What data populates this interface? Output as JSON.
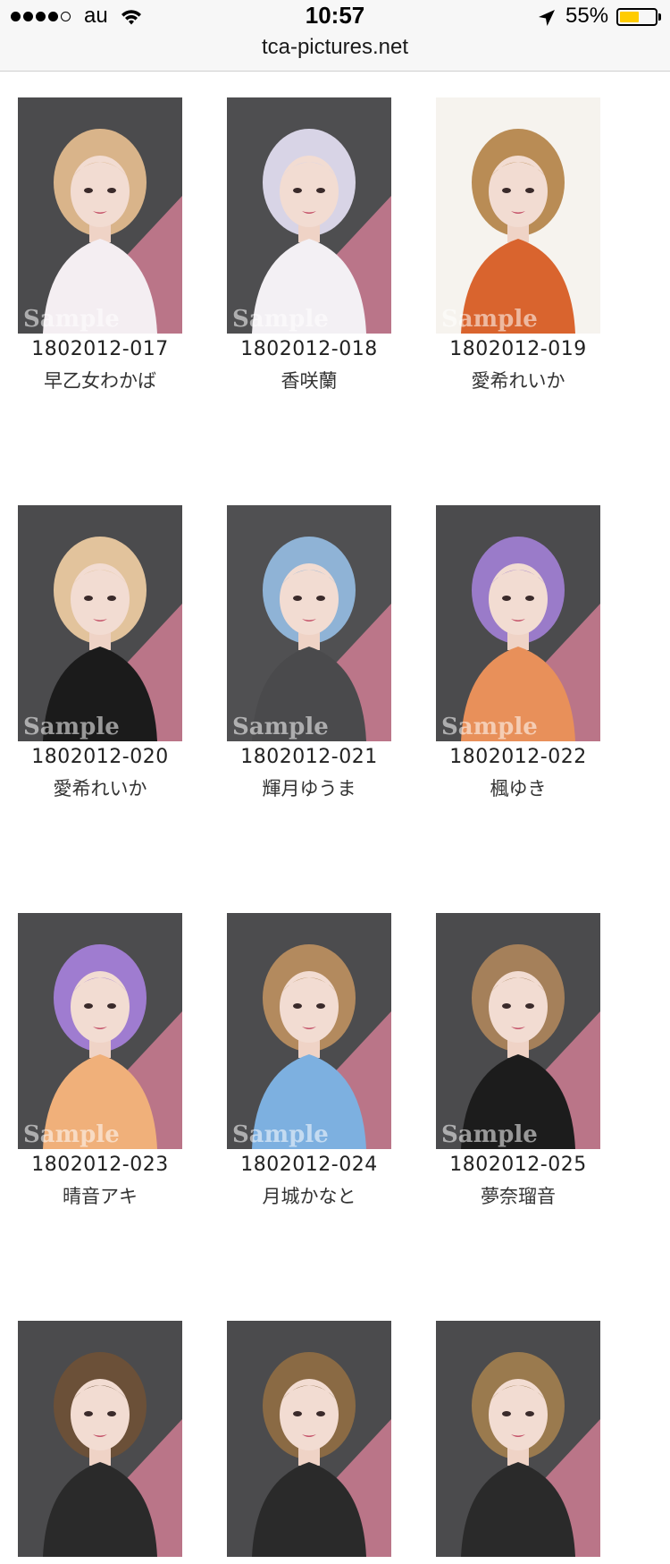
{
  "status_bar": {
    "carrier": "au",
    "time": "10:57",
    "battery_percent": "55%",
    "battery_level": 0.55,
    "signal_bars_filled": 4,
    "signal_bars_total": 5,
    "icons": [
      "wifi-icon",
      "location-arrow-icon",
      "battery-icon"
    ]
  },
  "browser": {
    "url": "tca-pictures.net"
  },
  "items": [
    {
      "code": "1802012-017",
      "name": "早乙女わかば",
      "watermark": "Sample",
      "bg": "#4b4b4d",
      "hair": "#d9b48a",
      "outfit": "#f4eef2",
      "accent": "#c77a8f",
      "light_bg": false
    },
    {
      "code": "1802012-018",
      "name": "香咲蘭",
      "watermark": "Sample",
      "bg": "#4e4e50",
      "hair": "#d8d4e6",
      "outfit": "#f3f0f4",
      "accent": "#c77a8f",
      "light_bg": false
    },
    {
      "code": "1802012-019",
      "name": "愛希れいか",
      "watermark": "Sample",
      "bg": "#f6f3ee",
      "hair": "#b98c55",
      "outfit": "#d9642e",
      "accent": "#f1e7b8",
      "light_bg": true
    },
    {
      "code": "1802012-020",
      "name": "愛希れいか",
      "watermark": "Sample",
      "bg": "#4b4b4d",
      "hair": "#e2c39c",
      "outfit": "#1b1b1b",
      "accent": "#c77a8f",
      "light_bg": false
    },
    {
      "code": "1802012-021",
      "name": "輝月ゆうま",
      "watermark": "Sample",
      "bg": "#505052",
      "hair": "#8fb3d6",
      "outfit": "#4a4a4c",
      "accent": "#c77a8f",
      "light_bg": false
    },
    {
      "code": "1802012-022",
      "name": "楓ゆき",
      "watermark": "Sample",
      "bg": "#4b4b4d",
      "hair": "#9a7bc9",
      "outfit": "#e8905a",
      "accent": "#c77a8f",
      "light_bg": false
    },
    {
      "code": "1802012-023",
      "name": "晴音アキ",
      "watermark": "Sample",
      "bg": "#4c4c4e",
      "hair": "#9f7cd0",
      "outfit": "#f0b07a",
      "accent": "#c77a8f",
      "light_bg": false
    },
    {
      "code": "1802012-024",
      "name": "月城かなと",
      "watermark": "Sample",
      "bg": "#4c4c4e",
      "hair": "#b38a5e",
      "outfit": "#7db0e0",
      "accent": "#c77a8f",
      "light_bg": false
    },
    {
      "code": "1802012-025",
      "name": "夢奈瑠音",
      "watermark": "Sample",
      "bg": "#4b4b4d",
      "hair": "#a5805a",
      "outfit": "#1c1c1c",
      "accent": "#c77a8f",
      "light_bg": false
    },
    {
      "code": "",
      "name": "",
      "watermark": "",
      "bg": "#4b4b4d",
      "hair": "#6b5038",
      "outfit": "#2a2a2a",
      "accent": "#c77a8f",
      "light_bg": false
    },
    {
      "code": "",
      "name": "",
      "watermark": "",
      "bg": "#4b4b4d",
      "hair": "#8a6a44",
      "outfit": "#2a2a2a",
      "accent": "#c77a8f",
      "light_bg": false
    },
    {
      "code": "",
      "name": "",
      "watermark": "",
      "bg": "#4b4b4d",
      "hair": "#9a7a4e",
      "outfit": "#2a2a2a",
      "accent": "#c77a8f",
      "light_bg": false
    }
  ]
}
